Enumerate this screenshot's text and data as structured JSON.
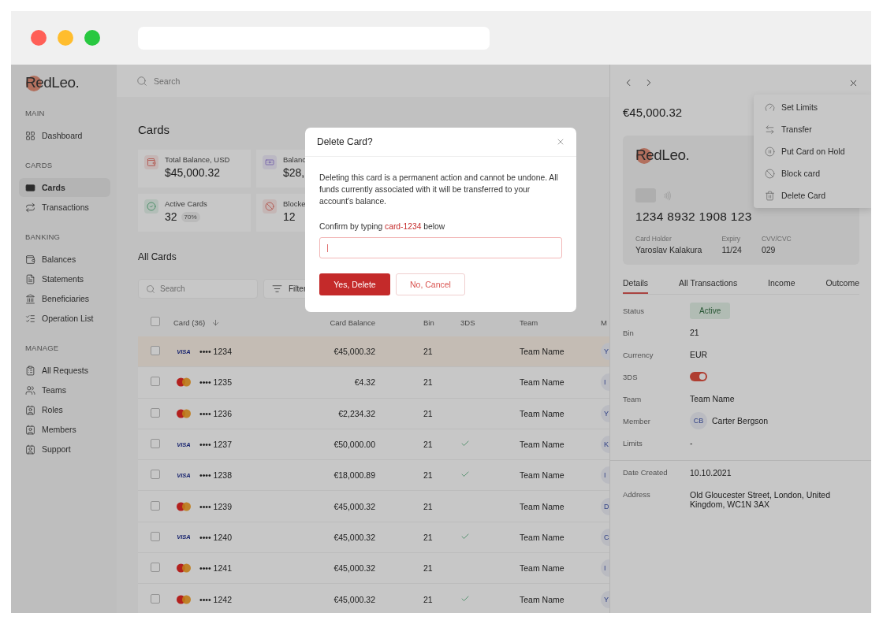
{
  "browser": {
    "dots": [
      {
        "color": "#ff5f57"
      },
      {
        "color": "#ffbd2e"
      },
      {
        "color": "#28c840"
      }
    ]
  },
  "sidebar": {
    "logo": "RedLeo.",
    "sections": [
      {
        "title": "MAIN",
        "items": [
          {
            "label": "Dashboard",
            "selected": false
          }
        ]
      },
      {
        "title": "CARDS",
        "items": [
          {
            "label": "Cards",
            "selected": true
          },
          {
            "label": "Transactions",
            "selected": false
          }
        ]
      },
      {
        "title": "BANKING",
        "items": [
          {
            "label": "Balances",
            "selected": false
          },
          {
            "label": "Statements",
            "selected": false
          },
          {
            "label": "Beneficiaries",
            "selected": false
          },
          {
            "label": "Operation List",
            "selected": false
          }
        ]
      },
      {
        "title": "MANAGE",
        "items": [
          {
            "label": "All Requests",
            "selected": false
          },
          {
            "label": "Teams",
            "selected": false
          },
          {
            "label": "Roles",
            "selected": false
          },
          {
            "label": "Members",
            "selected": false
          },
          {
            "label": "Support",
            "selected": false
          }
        ]
      }
    ]
  },
  "topbar": {
    "search_placeholder": "Search"
  },
  "page": {
    "title": "Cards",
    "stats": [
      {
        "label": "Total Balance, USD",
        "value": "$45,000.32"
      },
      {
        "label": "Balanc",
        "value": "$28,"
      },
      {
        "label": "Active Cards",
        "value": "32",
        "badge": "70%"
      },
      {
        "label": "Blocke",
        "value": "12"
      }
    ],
    "section_title": "All Cards",
    "search_placeholder": "Search",
    "filter_label": "Filter"
  },
  "table": {
    "header_checked": false,
    "columns": [
      "Card (36)",
      "Card Balance",
      "Bin",
      "3DS",
      "Team",
      "M"
    ],
    "rows": [
      {
        "brand": {
          "kind": "visa",
          "text": "VISA"
        },
        "number": "•••• 1234",
        "balance": "€45,000.32",
        "bin": "21",
        "three_ds": false,
        "team": "Team Name",
        "member": "Y",
        "checked": false,
        "selected": true
      },
      {
        "brand": {
          "kind": "mastercard"
        },
        "number": "•••• 1235",
        "balance": "€4.32",
        "bin": "21",
        "three_ds": false,
        "team": "Team Name",
        "member": "I",
        "checked": false,
        "selected": false
      },
      {
        "brand": {
          "kind": "mastercard"
        },
        "number": "•••• 1236",
        "balance": "€2,234.32",
        "bin": "21",
        "three_ds": false,
        "team": "Team Name",
        "member": "Y",
        "checked": false,
        "selected": false
      },
      {
        "brand": {
          "kind": "visa",
          "text": "VISA"
        },
        "number": "•••• 1237",
        "balance": "€50,000.00",
        "bin": "21",
        "three_ds": true,
        "team": "Team Name",
        "member": "K",
        "checked": false,
        "selected": false
      },
      {
        "brand": {
          "kind": "visa",
          "text": "VISA"
        },
        "number": "•••• 1238",
        "balance": "€18,000.89",
        "bin": "21",
        "three_ds": true,
        "team": "Team Name",
        "member": "I",
        "checked": false,
        "selected": false
      },
      {
        "brand": {
          "kind": "mastercard"
        },
        "number": "•••• 1239",
        "balance": "€45,000.32",
        "bin": "21",
        "three_ds": false,
        "team": "Team Name",
        "member": "D",
        "checked": false,
        "selected": false
      },
      {
        "brand": {
          "kind": "visa",
          "text": "VISA"
        },
        "number": "•••• 1240",
        "balance": "€45,000.32",
        "bin": "21",
        "three_ds": true,
        "team": "Team Name",
        "member": "C",
        "checked": false,
        "selected": false
      },
      {
        "brand": {
          "kind": "mastercard"
        },
        "number": "•••• 1241",
        "balance": "€45,000.32",
        "bin": "21",
        "three_ds": false,
        "team": "Team Name",
        "member": "I",
        "checked": false,
        "selected": false
      },
      {
        "brand": {
          "kind": "mastercard"
        },
        "number": "•••• 1242",
        "balance": "€45,000.32",
        "bin": "21",
        "three_ds": true,
        "team": "Team Name",
        "member": "Y",
        "checked": false,
        "selected": false
      }
    ]
  },
  "panel": {
    "amount": "€45,000.32",
    "card": {
      "logo": "RedLeo.",
      "number": "1234 8932 1908 123",
      "fields": [
        {
          "label": "Card Holder",
          "value": "Yaroslav Kalakura"
        },
        {
          "label": "Expiry",
          "value": "11/24"
        },
        {
          "label": "CVV/CVC",
          "value": "029"
        }
      ]
    },
    "tabs": [
      {
        "label": "Details",
        "selected": true
      },
      {
        "label": "All Transactions",
        "selected": false
      },
      {
        "label": "Income",
        "selected": false
      },
      {
        "label": "Outcome",
        "selected": false
      }
    ],
    "details": [
      {
        "kind": "badge",
        "label": "Status",
        "value": "Active"
      },
      {
        "kind": "text",
        "label": "Bin",
        "value": "21"
      },
      {
        "kind": "text",
        "label": "Currency",
        "value": "EUR"
      },
      {
        "kind": "toggle",
        "label": "3DS",
        "on": true
      },
      {
        "kind": "text",
        "label": "Team",
        "value": "Team Name"
      },
      {
        "kind": "member",
        "label": "Member",
        "initials": "CB",
        "value": "Carter Bergson"
      },
      {
        "kind": "text",
        "label": "Limits",
        "value": "-"
      }
    ],
    "extra": [
      {
        "label": "Date Created",
        "value": "10.10.2021"
      },
      {
        "label": "Address",
        "value": "Old Gloucester Street, London, United Kingdom, WC1N 3AX"
      }
    ]
  },
  "menu": {
    "items": [
      {
        "label": "Set Limits"
      },
      {
        "label": "Transfer"
      },
      {
        "label": "Put Card on Hold"
      },
      {
        "label": "Block card"
      },
      {
        "label": "Delete Card"
      }
    ]
  },
  "dialog": {
    "title": "Delete Card?",
    "message": "Deleting this card is a permanent action and cannot be undone. All funds currently associated with it will be transferred to your account's balance.",
    "confirm_prefix": "Confirm by typing",
    "confirm_code": "card-1234",
    "confirm_suffix": "below",
    "confirm_button": "Yes, Delete",
    "cancel_button": "No, Cancel"
  }
}
